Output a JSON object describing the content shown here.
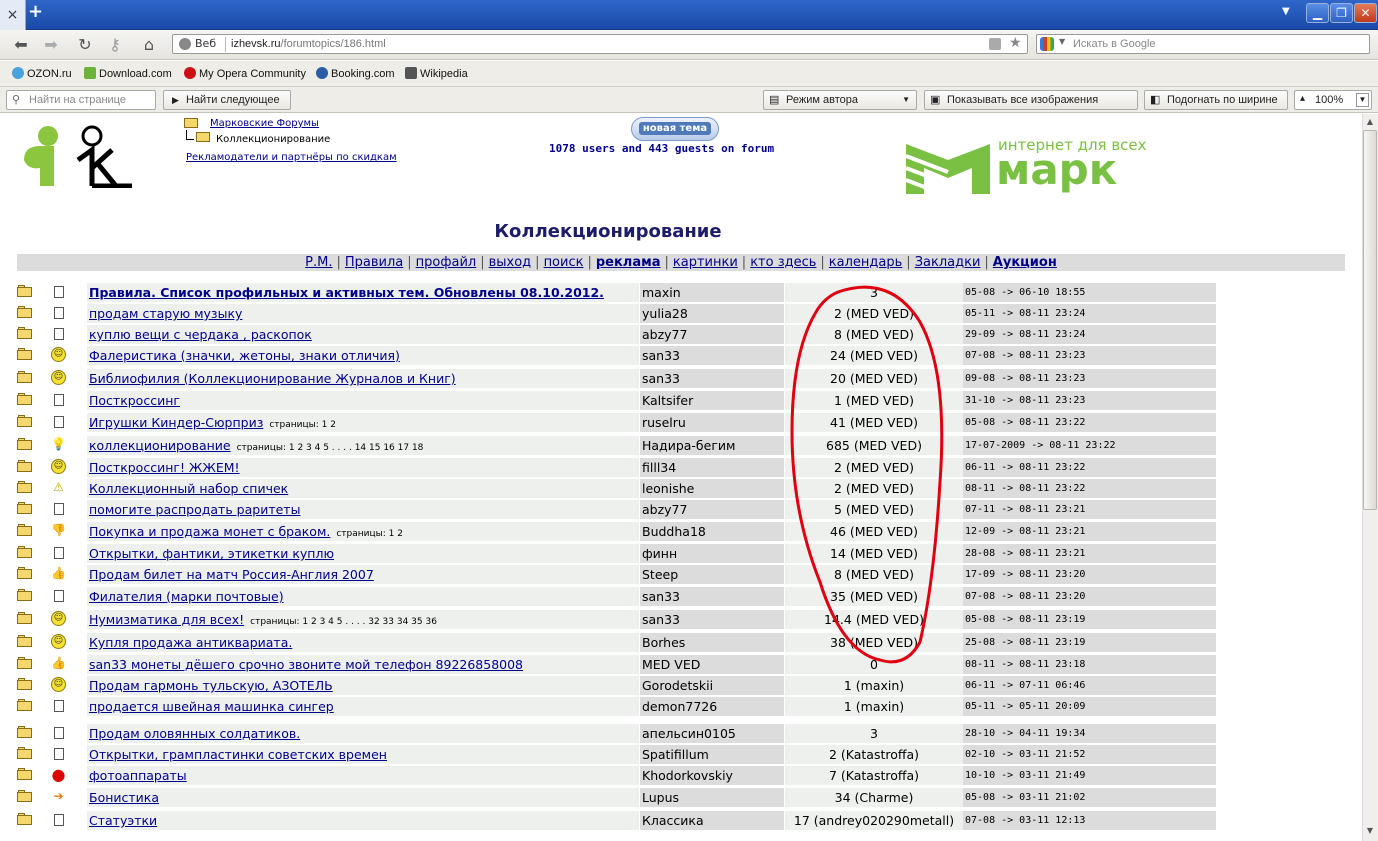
{
  "browser": {
    "tab_close": "×",
    "new_tab": "+",
    "address_prefix": "Веб",
    "url_host": "izhevsk.ru",
    "url_path": "/forumtopics/186.html",
    "search_placeholder": "Искать в Google",
    "bookmarks": [
      {
        "label": "OZON.ru",
        "color": "#4aa3df"
      },
      {
        "label": "Download.com",
        "color": "#6bb33a"
      },
      {
        "label": "My Opera Community",
        "color": "#cc0f16"
      },
      {
        "label": "Booking.com",
        "color": "#2a5fa8"
      },
      {
        "label": "Wikipedia",
        "color": "#555555"
      }
    ],
    "find_placeholder": "Найти на странице",
    "find_next": "Найти следующее",
    "author_mode": "Режим автора",
    "show_images": "Показывать все изображения",
    "fit_width": "Подогнать по ширине",
    "zoom": "100%"
  },
  "header": {
    "breadcrumb_root": "Марковские Форумы",
    "breadcrumb_current": "Коллекционирование",
    "advertisers": "Рекламодатели и партнёры по скидкам",
    "new_topic": "новая тема",
    "online": "1078 users and 443 guests on forum",
    "mark_tagline": "интернет для всех",
    "mark_name": "марк"
  },
  "page_title": "Коллекционирование",
  "menu": [
    "Р.М.",
    "Правила",
    "профайл",
    "выход",
    "поиск",
    "реклама",
    "картинки",
    "кто здесь",
    "календарь",
    "Закладки",
    "Аукцион"
  ],
  "topics": [
    {
      "title": "Правила. Список профильных и активных тем. Обновлены 08.10.2012.",
      "bold": true,
      "icon": "doc",
      "pages": "",
      "author": "maxin",
      "replies": "3",
      "date": "05-08 -> 06-10 18:55"
    },
    {
      "title": "продам старую музыку",
      "icon": "doc",
      "pages": "",
      "author": "yulia28",
      "replies": "2 (MED VED)",
      "date": "05-11 -> 08-11 23:24"
    },
    {
      "title": "куплю вещи с чердака , раскопок",
      "icon": "doc",
      "pages": "",
      "author": "abzy77",
      "replies": "8 (MED VED)",
      "date": "29-09 -> 08-11 23:24"
    },
    {
      "title": "Фалеристика (значки, жетоны, знаки отличия)",
      "icon": "smile",
      "pages": "",
      "author": "san33",
      "replies": "24 (MED VED)",
      "date": "07-08 -> 08-11 23:23"
    },
    {
      "title": "Библиофилия (Коллекционирование Журналов и Книг)",
      "icon": "smile",
      "pages": "",
      "author": "san33",
      "replies": "20 (MED VED)",
      "date": "09-08 -> 08-11 23:23"
    },
    {
      "title": "Посткроссинг",
      "icon": "doc",
      "pages": "",
      "author": "Kaltsifer",
      "replies": "1 (MED VED)",
      "date": "31-10 -> 08-11 23:23"
    },
    {
      "title": "Игрушки Киндер-Сюрприз",
      "icon": "doc",
      "pages": "страницы: 1 2",
      "author": "ruselru",
      "replies": "41 (MED VED)",
      "date": "05-08 -> 08-11 23:22"
    },
    {
      "title": "коллекционирование",
      "icon": "bulb",
      "pages": "страницы: 1 2 3 4 5 . . . .  14 15 16 17 18",
      "author": "Надира-бегим",
      "replies": "685 (MED VED)",
      "date": "17-07-2009 -> 08-11 23:22"
    },
    {
      "title": "Посткроссинг! ЖЖЕМ!",
      "icon": "smile",
      "pages": "",
      "author": "filll34",
      "replies": "2 (MED VED)",
      "date": "06-11 -> 08-11 23:22"
    },
    {
      "title": "Коллекционный набор спичек",
      "icon": "warn",
      "pages": "",
      "author": "leonishe",
      "replies": "2 (MED VED)",
      "date": "08-11 -> 08-11 23:22"
    },
    {
      "title": "помогите распродать раритеты",
      "icon": "doc",
      "pages": "",
      "author": "abzy77",
      "replies": "5 (MED VED)",
      "date": "07-11 -> 08-11 23:21"
    },
    {
      "title": "Покупка и продажа монет с браком.",
      "icon": "thumbdown",
      "pages": "страницы: 1 2",
      "author": "Buddha18",
      "replies": "46 (MED VED)",
      "date": "12-09 -> 08-11 23:21"
    },
    {
      "title": "Открытки, фантики, этикетки куплю",
      "icon": "doc",
      "pages": "",
      "author": "финн",
      "replies": "14 (MED VED)",
      "date": "28-08 -> 08-11 23:21"
    },
    {
      "title": "Продам билет на матч Россия-Англия 2007",
      "icon": "thumbup",
      "pages": "",
      "author": "Steep",
      "replies": "8 (MED VED)",
      "date": "17-09 -> 08-11 23:20"
    },
    {
      "title": "Филателия (марки почтовые)",
      "icon": "doc",
      "pages": "",
      "author": "san33",
      "replies": "35 (MED VED)",
      "date": "07-08 -> 08-11 23:20"
    },
    {
      "title": "Нумизматика для всех!",
      "icon": "smile",
      "pages": "страницы: 1 2 3 4 5 . . . .  32 33 34 35 36",
      "author": "san33",
      "replies": "14.4 (MED VED)",
      "date": "05-08 -> 08-11 23:19"
    },
    {
      "title": "Купля продажа антиквариата.",
      "icon": "smile",
      "pages": "",
      "author": "Borhes",
      "replies": "38 (MED VED)",
      "date": "25-08 -> 08-11 23:19"
    },
    {
      "title": "san33 монеты дёшего срочно звоните мой телефон 89226858008",
      "icon": "thumbup",
      "pages": "",
      "author": "MED VED",
      "replies": "0",
      "date": "08-11 -> 08-11 23:18"
    },
    {
      "title": "Продам гармонь тульскую, АЗОТЕЛЬ",
      "icon": "smile",
      "pages": "",
      "author": "Gorodetskii",
      "replies": "1 (maxin)",
      "date": "06-11 -> 07-11 06:46"
    },
    {
      "title": "продается швейная машинка сингер",
      "icon": "doc",
      "pages": "",
      "author": "demon7726",
      "replies": "1 (maxin)",
      "date": "05-11 -> 05-11 20:09"
    },
    {
      "title": "Продам оловянных солдатиков.",
      "icon": "doc",
      "pages": "",
      "author": "апельсин0105",
      "replies": "3",
      "date": "28-10 -> 04-11 19:34"
    },
    {
      "title": "Открытки, грампластинки советских времен",
      "icon": "doc",
      "pages": "",
      "author": "Spatifillum",
      "replies": "2 (Katastroffa)",
      "date": "02-10 -> 03-11 21:52"
    },
    {
      "title": "фотоаппараты",
      "icon": "redcircle",
      "pages": "",
      "author": "Khodorkovskiy",
      "replies": "7 (Katastroffa)",
      "date": "10-10 -> 03-11 21:49"
    },
    {
      "title": "Бонистика",
      "icon": "arrow",
      "pages": "",
      "author": "Lupus",
      "replies": "34 (Charme)",
      "date": "05-08 -> 03-11 21:02"
    },
    {
      "title": "Статуэтки",
      "icon": "doc",
      "pages": "",
      "author": "Классика",
      "replies": "17 (andrey020290metall)",
      "date": "07-08 -> 03-11 12:13"
    }
  ],
  "colors": {
    "link": "#00008b",
    "annotation": "#e0000f",
    "mark_green": "#7ac043"
  }
}
